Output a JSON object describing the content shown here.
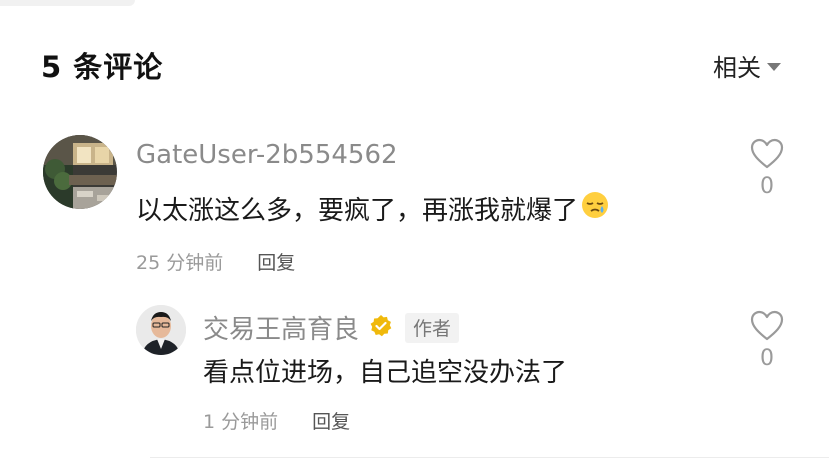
{
  "header": {
    "title": "5 条评论",
    "sort_label": "相关"
  },
  "comments": [
    {
      "username": "GateUser-2b554562",
      "content": "以太涨这么多，要疯了，再涨我就爆了",
      "emoji": "sleepy-face",
      "time": "25 分钟前",
      "reply_label": "回复",
      "likes": "0",
      "replies": [
        {
          "username": "交易王高育良",
          "badge": "作者",
          "content": "看点位进场，自己追空没办法了",
          "time": "1 分钟前",
          "reply_label": "回复",
          "likes": "0"
        }
      ]
    }
  ],
  "colors": {
    "verified_badge": "#f0b90b",
    "username": "#8a8a8a",
    "muted": "#9a9a9a"
  }
}
